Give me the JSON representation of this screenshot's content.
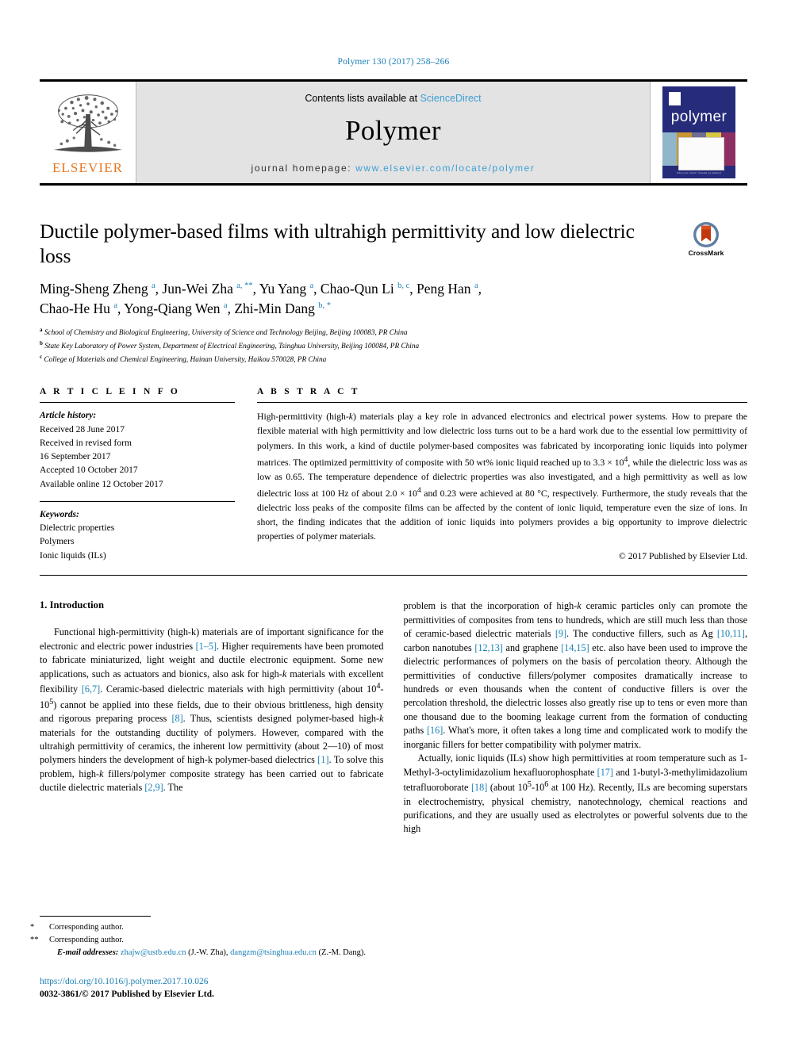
{
  "running_head": "Polymer 130 (2017) 258–266",
  "masthead": {
    "publisher_name": "ELSEVIER",
    "contents_prefix": "Contents lists available at ",
    "contents_link": "ScienceDirect",
    "journal_name": "Polymer",
    "homepage_prefix": "journal homepage: ",
    "homepage_url": "www.elsevier.com/locate/polymer",
    "cover_title": "polymer",
    "cover_footer": "Editor-in-Chief: Saleem Al-Ahmad",
    "link_color": "#3c9fd6"
  },
  "article": {
    "title": "Ductile polymer-based films with ultrahigh permittivity and low dielectric loss",
    "crossmark_label": "CrossMark",
    "authors_line1_html": "Ming-Sheng Zheng <sup>a</sup>, Jun-Wei Zha <sup>a, **</sup>, Yu Yang <sup>a</sup>, Chao-Qun Li <sup>b, c</sup>, Peng Han <sup>a</sup>,",
    "authors_line2_html": "Chao-He Hu <sup>a</sup>, Yong-Qiang Wen <sup>a</sup>, Zhi-Min Dang <sup>b, *</sup>",
    "affiliations": [
      {
        "marker": "a",
        "text": "School of Chemistry and Biological Engineering, University of Science and Technology Beijing, Beijing 100083, PR China"
      },
      {
        "marker": "b",
        "text": "State Key Laboratory of Power System, Department of Electrical Engineering, Tsinghua University, Beijing 100084, PR China"
      },
      {
        "marker": "c",
        "text": "College of Materials and Chemical Engineering, Hainan University, Haikou 570028, PR China"
      }
    ]
  },
  "article_info": {
    "heading": "A R T I C L E   I N F O",
    "history_label": "Article history:",
    "history": [
      "Received 28 June 2017",
      "Received in revised form",
      "16 September 2017",
      "Accepted 10 October 2017",
      "Available online 12 October 2017"
    ],
    "keywords_label": "Keywords:",
    "keywords": [
      "Dielectric properties",
      "Polymers",
      "Ionic liquids (ILs)"
    ]
  },
  "abstract": {
    "heading": "A B S T R A C T",
    "text_html": "High-permittivity (high-<i>k</i>) materials play a key role in advanced electronics and electrical power systems. How to prepare the flexible material with high permittivity and low dielectric loss turns out to be a hard work due to the essential low permittivity of polymers. In this work, a kind of ductile polymer-based composites was fabricated by incorporating ionic liquids into polymer matrices. The optimized permittivity of composite with 50 wt% ionic liquid reached up to 3.3 &times; 10<sup>4</sup>, while the dielectric loss was as low as 0.65. The temperature dependence of dielectric properties was also investigated, and a high permittivity as well as low dielectric loss at 100 Hz of about 2.0 &times; 10<sup>4</sup> and 0.23 were achieved at 80 &deg;C, respectively. Furthermore, the study reveals that the dielectric loss peaks of the composite films can be affected by the content of ionic liquid, temperature even the size of ions. In short, the finding indicates that the addition of ionic liquids into polymers provides a big opportunity to improve dielectric properties of polymer materials.",
    "copyright": "© 2017 Published by Elsevier Ltd."
  },
  "body": {
    "section_number_title": "1.  Introduction",
    "left_paragraph_html": "Functional high-permittivity (high-k) materials are of important significance for the electronic and electric power industries <span class=\"ref\">[1&ndash;5]</span>. Higher requirements have been promoted to fabricate miniaturized, light weight and ductile electronic equipment. Some new applications, such as actuators and bionics, also ask for high-<i>k</i> materials with excellent flexibility <span class=\"ref\">[6,7]</span>. Ceramic-based dielectric materials with high permittivity (about 10<sup>4</sup>-10<sup>5</sup>) cannot be applied into these fields, due to their obvious brittleness, high density and rigorous preparing process <span class=\"ref\">[8]</span>. Thus, scientists designed polymer-based high-<i>k</i> materials for the outstanding ductility of polymers. However, compared with the ultrahigh permittivity of ceramics, the inherent low permittivity (about 2&mdash;10) of most polymers hinders the development of high-k polymer-based dielectrics <span class=\"ref\">[1]</span>. To solve this problem, high-<i>k</i> fillers/polymer composite strategy has been carried out to fabricate ductile dielectric materials <span class=\"ref\">[2,9]</span>. The",
    "right_paragraph1_html": "problem is that the incorporation of high-<i>k</i> ceramic particles only can promote the permittivities of composites from tens to hundreds, which are still much less than those of ceramic-based dielectric materials <span class=\"ref\">[9]</span>. The conductive fillers, such as Ag <span class=\"ref\">[10,11]</span>, carbon nanotubes <span class=\"ref\">[12,13]</span> and graphene <span class=\"ref\">[14,15]</span> etc. also have been used to improve the dielectric performances of polymers on the basis of percolation theory. Although the permittivities of conductive fillers/polymer composites dramatically increase to hundreds or even thousands when the content of conductive fillers is over the percolation threshold, the dielectric losses also greatly rise up to tens or even more than one thousand due to the booming leakage current from the formation of conducting paths <span class=\"ref\">[16]</span>. What's more, it often takes a long time and complicated work to modify the inorganic fillers for better compatibility with polymer matrix.",
    "right_paragraph2_html": "Actually, ionic liquids (ILs) show high permittivities at room temperature such as 1-Methyl-3-octylimidazolium hexafluorophosphate <span class=\"ref\">[17]</span> and 1-butyl-3-methylimidazolium tetrafluoroborate <span class=\"ref\">[18]</span> (about 10<sup>5</sup>-10<sup>6</sup> at 100 Hz). Recently, ILs are becoming superstars in electrochemistry, physical chemistry, nanotechnology, chemical reactions and purifications, and they are usually used as electrolytes or powerful solvents due to the high"
  },
  "footnotes": {
    "corresponding1": "Corresponding author.",
    "corresponding2": "Corresponding author.",
    "email_label": "E-mail addresses:",
    "email1": "zhajw@ustb.edu.cn",
    "email1_owner": "(J.-W. Zha)",
    "email2": "dangzm@tsinghua.edu.cn",
    "email2_owner": "(Z.-M. Dang).",
    "doi": "https://doi.org/10.1016/j.polymer.2017.10.026",
    "issn_line": "0032-3861/© 2017 Published by Elsevier Ltd."
  }
}
